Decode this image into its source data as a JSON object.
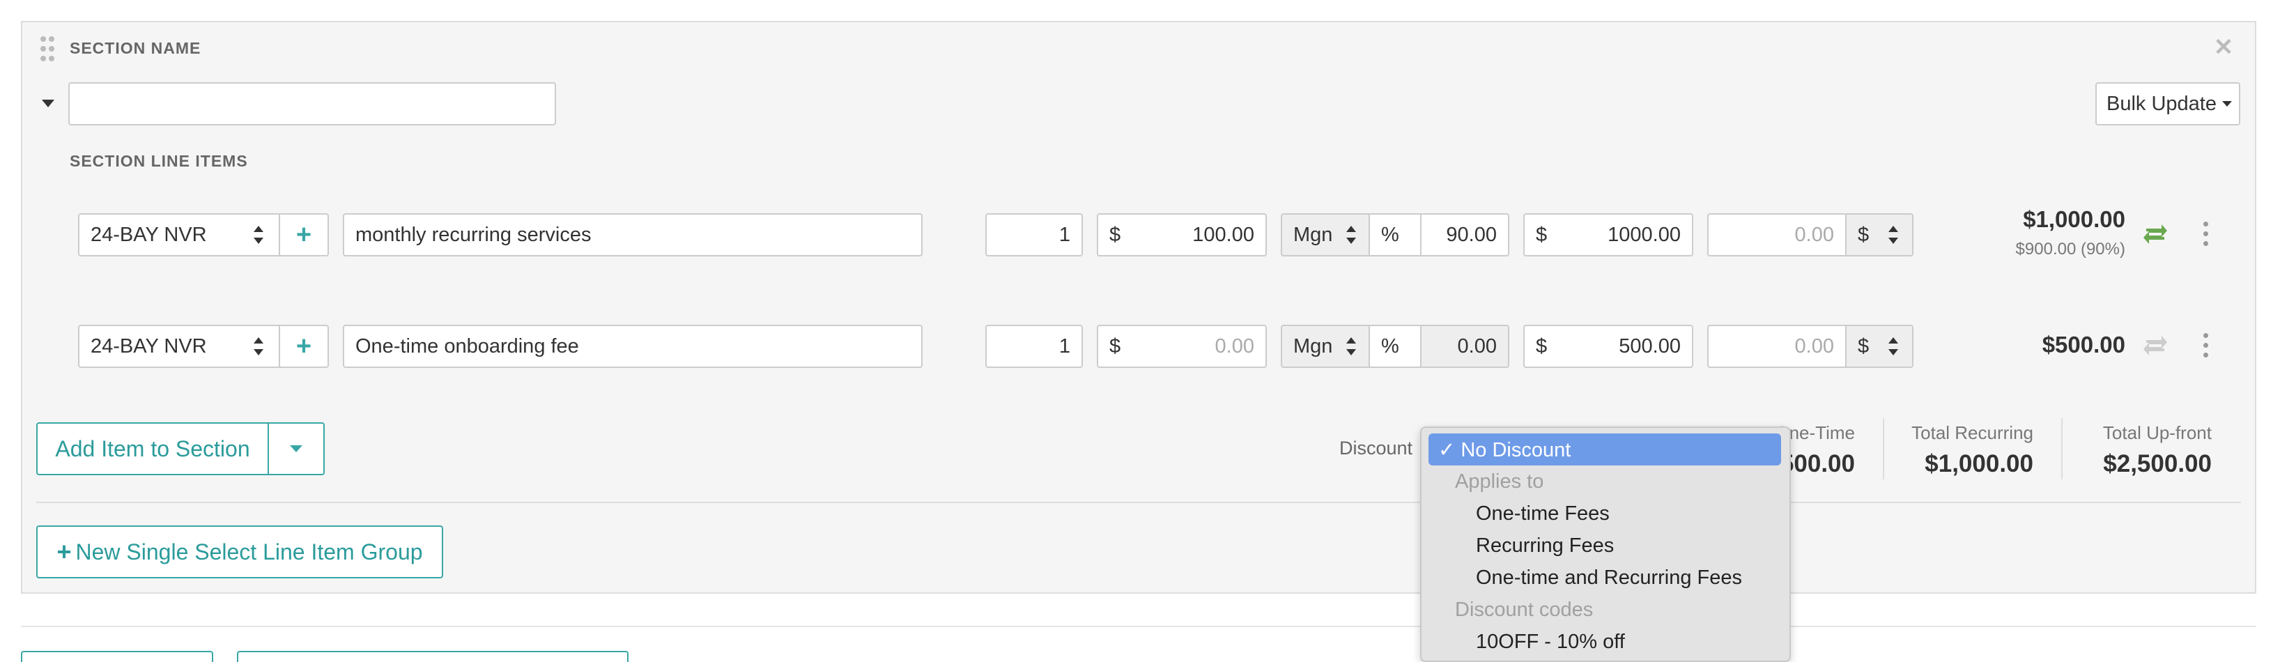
{
  "section": {
    "title": "SECTION NAME",
    "name_value": "",
    "bulk_update_label": "Bulk Update",
    "line_items_label": "SECTION LINE ITEMS"
  },
  "line_items": [
    {
      "product": "24-BAY NVR",
      "description": "monthly recurring services",
      "quantity": "1",
      "cost_prefix": "$",
      "cost": "100.00",
      "markup_type": "Mgn",
      "percent_prefix": "%",
      "percent": "90.00",
      "price_prefix": "$",
      "price": "1000.00",
      "discount_placeholder": "0.00",
      "discount_unit": "$",
      "total": "$1,000.00",
      "subtotal_note": "$900.00 (90%)",
      "recurring_active": true
    },
    {
      "product": "24-BAY NVR",
      "description": "One-time onboarding fee",
      "quantity": "1",
      "cost_prefix": "$",
      "cost": "0.00",
      "markup_type": "Mgn",
      "percent_prefix": "%",
      "percent": "0.00",
      "price_prefix": "$",
      "price": "500.00",
      "discount_placeholder": "0.00",
      "discount_unit": "$",
      "total": "$500.00",
      "subtotal_note": "",
      "recurring_active": false
    }
  ],
  "footer": {
    "add_item_label": "Add Item to Section",
    "discount_label": "Discount",
    "totals": [
      {
        "label": "One-Time",
        "value": "$500.00"
      },
      {
        "label": "Total Recurring",
        "value": "$1,000.00"
      },
      {
        "label": "Total Up-front",
        "value": "$2,500.00"
      }
    ],
    "new_group_label": "New Single Select Line Item Group"
  },
  "discount_dropdown": {
    "selected": "✓ No Discount",
    "group_applies": "Applies to",
    "applies_options": [
      "One-time Fees",
      "Recurring Fees",
      "One-time and Recurring Fees"
    ],
    "group_codes": "Discount codes",
    "code_options": [
      "10OFF - 10% off"
    ]
  },
  "colors": {
    "accent": "#39a6a6",
    "recurring_icon_active": "#6aa84f",
    "recurring_icon_inactive": "#cccccc",
    "selected_option": "#6e9be8"
  }
}
